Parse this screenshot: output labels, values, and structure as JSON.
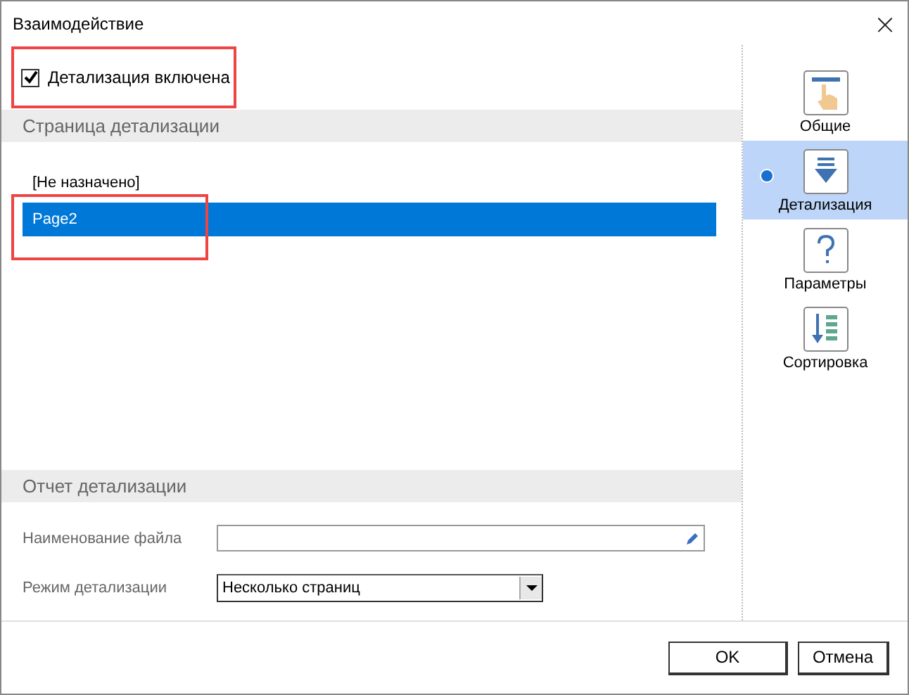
{
  "window": {
    "title": "Взаимодействие",
    "close": "×"
  },
  "drilldown_toggle": {
    "label": "Детализация включена",
    "checked": true,
    "highlighted": true
  },
  "page_section": {
    "title": "Страница детализации",
    "items": [
      {
        "label": "[Не назначено]",
        "selected": false,
        "highlighted": false
      },
      {
        "label": "Page2",
        "selected": true,
        "highlighted": true
      }
    ]
  },
  "report_section": {
    "title": "Отчет детализации",
    "fields": [
      {
        "kind": "text",
        "label": "Наименование файла"
      },
      {
        "kind": "combo",
        "label": "Режим детализации",
        "value": "Несколько страниц"
      }
    ]
  },
  "nav": [
    {
      "kind": "hand",
      "label": "Общие",
      "selected": false
    },
    {
      "kind": "down",
      "label": "Детализация",
      "selected": true
    },
    {
      "kind": "question",
      "label": "Параметры",
      "selected": false
    },
    {
      "kind": "sort",
      "label": "Сортировка",
      "selected": false
    }
  ],
  "buttons": [
    "OK",
    "Отмена"
  ]
}
